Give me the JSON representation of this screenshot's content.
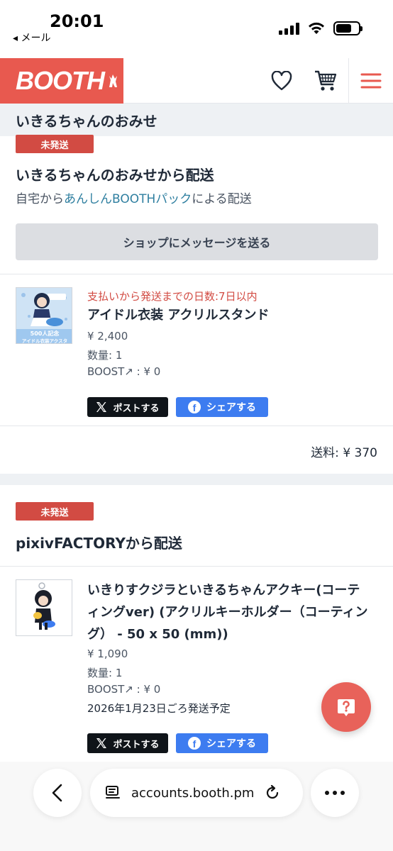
{
  "status_bar": {
    "time": "20:01",
    "back_label": "◂ メール"
  },
  "header": {
    "logo": "BOOTH"
  },
  "shop_bar": {
    "title": "いきるちゃんのおみせ"
  },
  "order1": {
    "status_badge": "未発送",
    "shipper_title": "いきるちゃんのおみせから配送",
    "sub_prefix": "自宅から",
    "sub_link": "あんしんBOOTHパック",
    "sub_suffix": "による配送",
    "message_button": "ショップにメッセージを送る",
    "item": {
      "deadline": "支払いから発送までの日数:7日以内",
      "name": "アイドル衣装 アクリルスタンド",
      "price": "¥ 2,400",
      "quantity": "数量: 1",
      "boost": "BOOST↗ : ¥ 0",
      "thumb_caption_1": "500人記念",
      "thumb_caption_2": "アイドル衣装アクスタ"
    },
    "share_x": "ポストする",
    "share_fb": "シェアする",
    "shipping_fee": "送料: ¥ 370"
  },
  "order2": {
    "status_badge": "未発送",
    "shipper_title": "pixivFACTORYから配送",
    "item": {
      "name_line1": "いきりすクジラといきるちゃんアクキー(コーテ",
      "name_line2": "ィングver) (アクリルキーホルダー（コーティン",
      "name_line3": "グ） - 50 x 50 (mm))",
      "price": "¥ 1,090",
      "quantity": "数量: 1",
      "boost": "BOOST↗ : ¥ 0",
      "ship_date": "2026年1月23日ごろ発送予定"
    },
    "share_x": "ポストする",
    "share_fb": "シェアする"
  },
  "browser": {
    "url": "accounts.booth.pm"
  },
  "colors": {
    "brand": "#e8594f",
    "badge": "#d24b43",
    "link": "#2f7fa0",
    "facebook": "#3d7cf0",
    "x": "#0f1419"
  }
}
